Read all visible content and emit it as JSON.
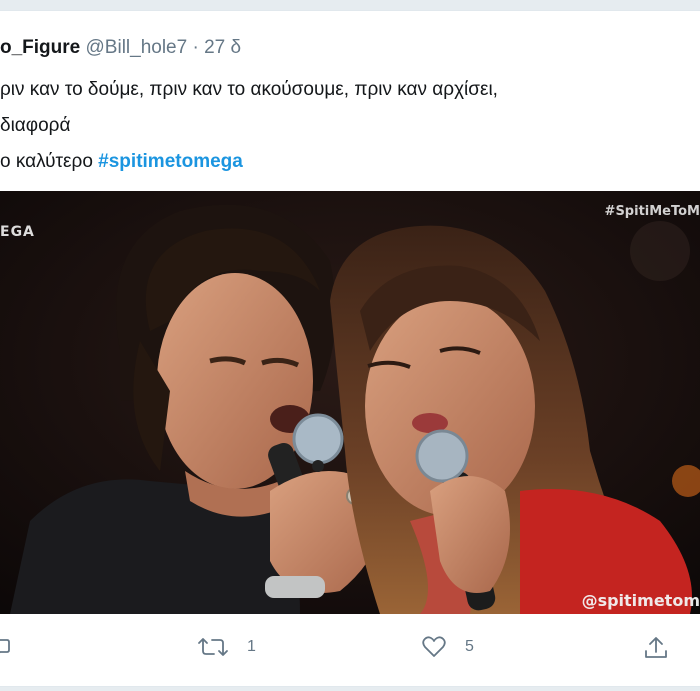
{
  "tweet": {
    "display_name": "o_Figure",
    "handle": "@Bill_hole7",
    "separator": "·",
    "time": "27 δ",
    "text_line1": "ριν καν το δούμε, πριν καν το ακούσουμε, πριν καν αρχίσει,",
    "text_line2": "διαφορά",
    "text_line3_prefix": "ο καλύτερο ",
    "hashtag": "#spitimetomega"
  },
  "media": {
    "watermark_top": "#SpitiMeToM",
    "channel_logo": "EGA",
    "watermark_bottom": "@spitimetom"
  },
  "actions": {
    "retweet_count": "1",
    "like_count": "5"
  },
  "icons": {
    "reply": "reply-icon",
    "retweet": "retweet-icon",
    "like": "heart-icon",
    "share": "share-icon"
  },
  "colors": {
    "link": "#1b95e0",
    "secondary_text": "#657786",
    "background": "#e6ecf0"
  }
}
